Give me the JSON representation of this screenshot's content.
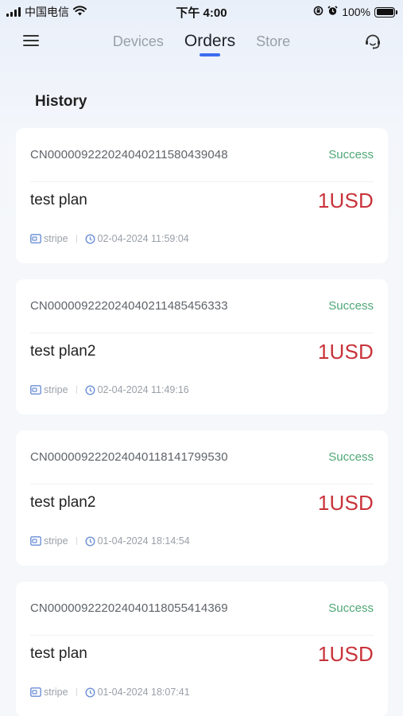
{
  "status_bar": {
    "carrier": "中国电信",
    "time": "下午 4:00",
    "battery": "100%"
  },
  "nav": {
    "tabs": [
      {
        "label": "Devices",
        "active": false
      },
      {
        "label": "Orders",
        "active": true
      },
      {
        "label": "Store",
        "active": false
      }
    ]
  },
  "section_title": "History",
  "colors": {
    "accent": "#3c6cf0",
    "success": "#4fa877",
    "price": "#c8333a"
  },
  "orders": [
    {
      "id": "CN00000922202404021158043904​8",
      "status": "Success",
      "plan": "test plan",
      "price": "1USD",
      "method": "stripe",
      "date": "02-04-2024 11:59:04"
    },
    {
      "id": "CN000009222024040211485456333",
      "status": "Success",
      "plan": "test plan2",
      "price": "1USD",
      "method": "stripe",
      "date": "02-04-2024 11:49:16"
    },
    {
      "id": "CN000009222024040118141799530",
      "status": "Success",
      "plan": "test plan2",
      "price": "1USD",
      "method": "stripe",
      "date": "01-04-2024 18:14:54"
    },
    {
      "id": "CN000009222024040118055414369",
      "status": "Success",
      "plan": "test plan",
      "price": "1USD",
      "method": "stripe",
      "date": "01-04-2024 18:07:41"
    }
  ]
}
